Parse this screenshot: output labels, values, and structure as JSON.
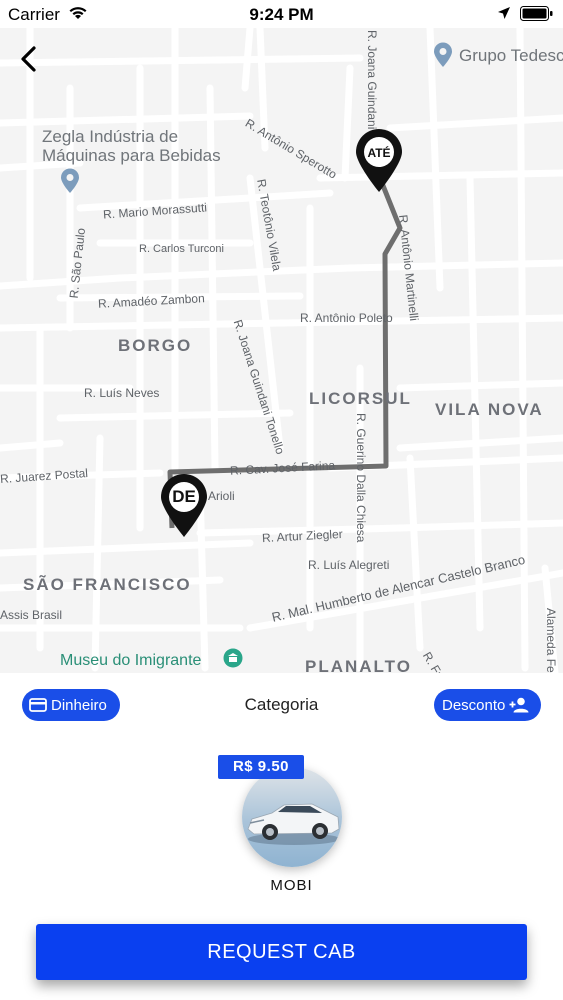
{
  "status_bar": {
    "carrier": "Carrier",
    "time": "9:24 PM"
  },
  "map": {
    "pins": {
      "destination": "ATÉ",
      "origin": "DE"
    },
    "pois": {
      "zegla_line1": "Zegla Indústria de",
      "zegla_line2": "Máquinas para Bebidas",
      "grupo": "Grupo Tedesc",
      "museu": "Museu do Imigrante"
    },
    "districts": {
      "borgo": "BORGO",
      "licorsul": "LICORSUL",
      "vila_nova": "VILA NOVA",
      "sao_francisco": "SÃO FRANCISCO",
      "planalto": "PLANALTO"
    },
    "streets": {
      "joana_guindani_top": "R. Joana Guindani",
      "antonio_sperotto": "R. Antônio Sperotto",
      "teotonio_viela": "R. Teotônio Vilela",
      "antonio_martinelli": "R. Antônio Martinelli",
      "mario_morassutti": "R. Mario Morassutti",
      "carlos_turconi": "R. Carlos Turconi",
      "sao_paulo": "R. São Paulo",
      "amadeo_zambon": "R. Amadéo Zambon",
      "antonio_poleto": "R. Antônio Poleto",
      "joana_guindani_tonello": "R. Joana Guindani Tonello",
      "luis_neves": "R. Luís Neves",
      "guerino_dalla_chiesa": "R. Guerino Dalla Chiesa",
      "juarez_postal": "R. Juarez Postal",
      "cav_jose_farina": "R. Cav. José Farina",
      "arioli": "Arioli",
      "artur_ziegler": "R. Artur Ziegler",
      "luis_alegreti": "R. Luís Alegreti",
      "humberto_alencar": "R. Mal. Humberto de Alencar Castelo Branco",
      "assis_brasil": "Assis Brasil",
      "alameda_fenavinho": "Alameda Fenavinho",
      "fr": "R. Fr"
    }
  },
  "panel": {
    "payment_label": "Dinheiro",
    "category_title": "Categoria",
    "discount_label": "Desconto",
    "vehicle": {
      "price": "R$ 9.50",
      "name": "MOBI"
    },
    "request_button": "REQUEST CAB"
  },
  "colors": {
    "accent": "#1a4ee8",
    "request_button": "#0a40f0",
    "route": "#6e6e6e"
  }
}
